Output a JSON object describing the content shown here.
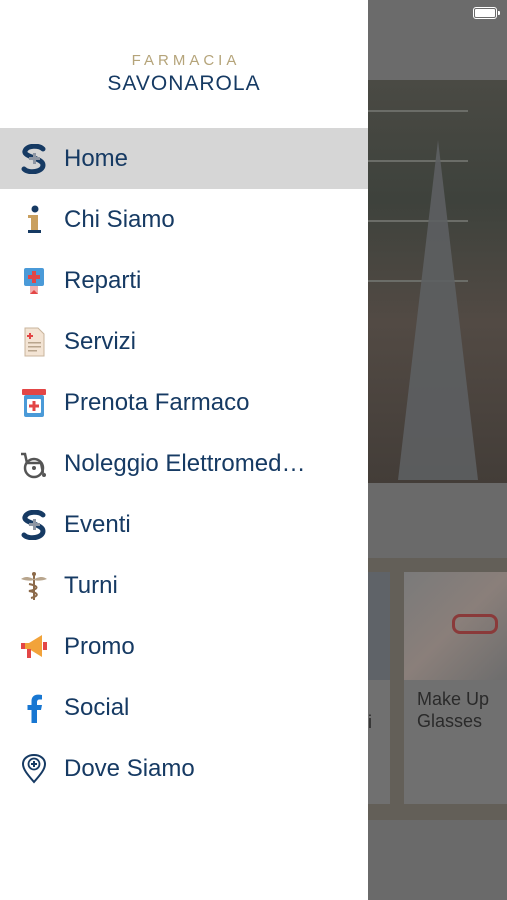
{
  "brand": {
    "subtitle": "FARMACIA",
    "title": "SAVONAROLA"
  },
  "menu": [
    {
      "label": "Home",
      "icon": "brand-s-icon",
      "active": true
    },
    {
      "label": "Chi Siamo",
      "icon": "info-icon"
    },
    {
      "label": "Reparti",
      "icon": "pharmacy-sign-icon"
    },
    {
      "label": "Servizi",
      "icon": "document-icon"
    },
    {
      "label": "Prenota Farmaco",
      "icon": "medicine-jar-icon"
    },
    {
      "label": "Noleggio Elettromed…",
      "icon": "wheelchair-icon"
    },
    {
      "label": "Eventi",
      "icon": "brand-s-icon"
    },
    {
      "label": "Turni",
      "icon": "caduceus-icon"
    },
    {
      "label": "Promo",
      "icon": "megaphone-icon"
    },
    {
      "label": "Social",
      "icon": "facebook-icon"
    },
    {
      "label": "Dove Siamo",
      "icon": "map-pin-icon"
    }
  ],
  "background": {
    "card2_title": "Make Up Glasses",
    "card1_fragment": "i"
  },
  "colors": {
    "brand_navy": "#163a63",
    "brand_gold": "#b5a47a",
    "active_row": "#d6d6d6"
  }
}
